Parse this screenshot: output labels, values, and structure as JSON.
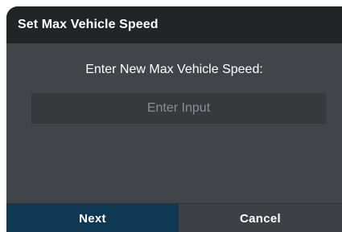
{
  "dialog": {
    "title": "Set Max Vehicle Speed",
    "prompt": "Enter New Max Vehicle Speed:",
    "input": {
      "value": "",
      "placeholder": "Enter Input"
    },
    "buttons": {
      "next_label": "Next",
      "cancel_label": "Cancel"
    }
  },
  "colors": {
    "title_bar": "#222426",
    "body": "#414549",
    "input_bg": "#373a3d",
    "primary_button": "#0f3853",
    "secondary_button": "#3d4145"
  }
}
